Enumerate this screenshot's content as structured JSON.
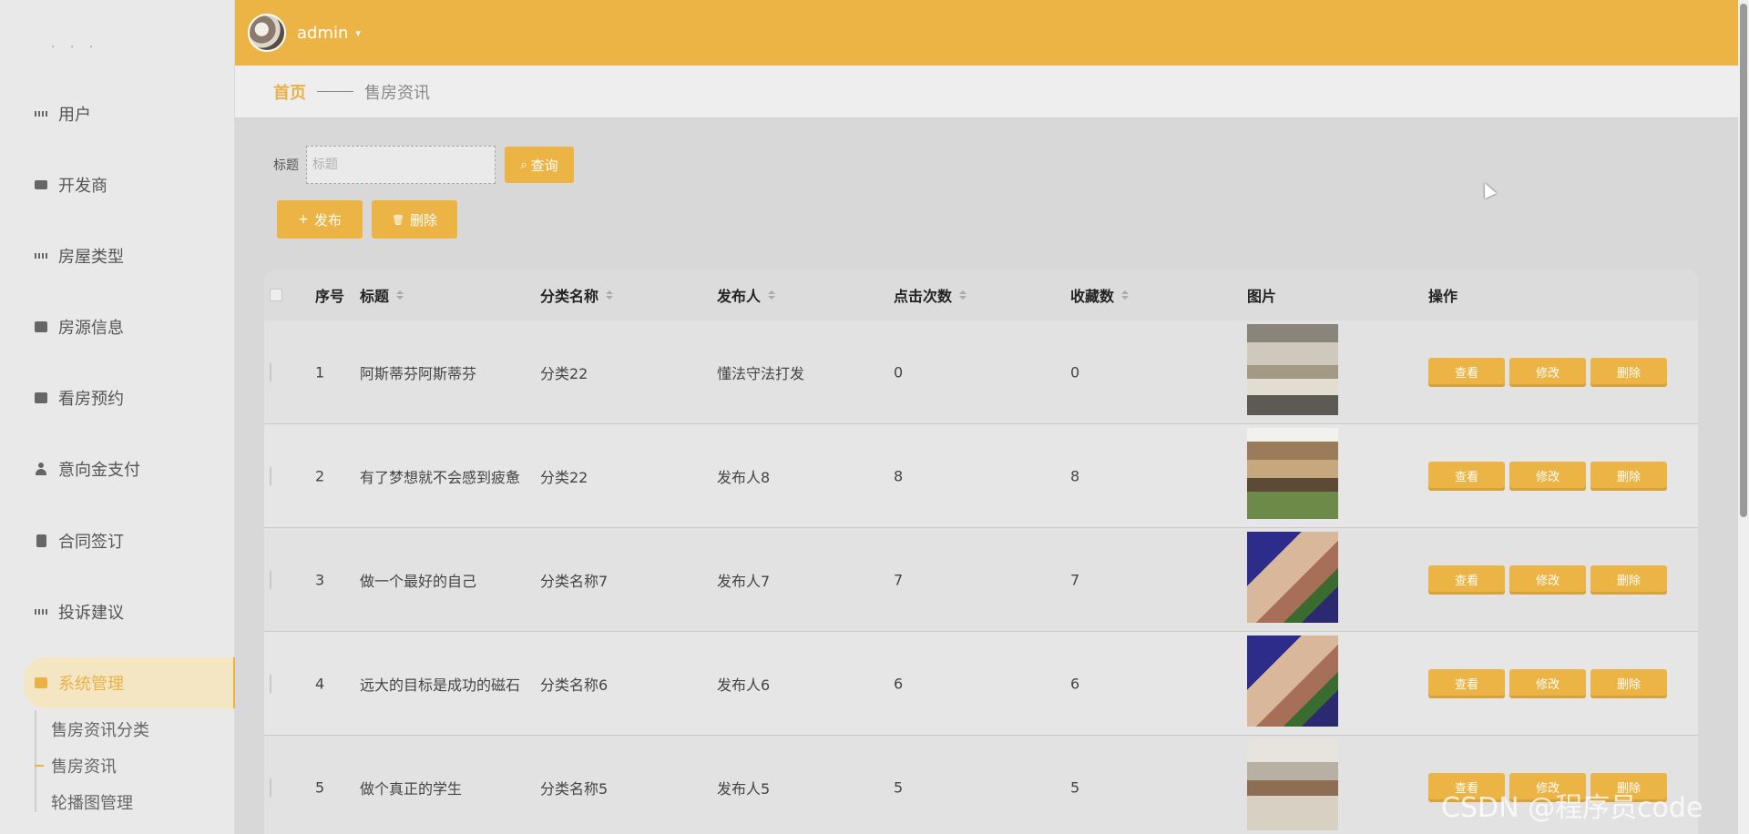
{
  "sidebar": {
    "dots": "· · ·",
    "items": [
      {
        "label": "用户",
        "icon": "grid-icon"
      },
      {
        "label": "开发商",
        "icon": "wallet-icon"
      },
      {
        "label": "房屋类型",
        "icon": "grid-icon"
      },
      {
        "label": "房源信息",
        "icon": "briefcase-icon"
      },
      {
        "label": "看房预约",
        "icon": "chart-icon"
      },
      {
        "label": "意向金支付",
        "icon": "user-icon"
      },
      {
        "label": "合同签订",
        "icon": "clipboard-icon"
      },
      {
        "label": "投诉建议",
        "icon": "grid-icon"
      },
      {
        "label": "系统管理",
        "icon": "monitor-icon",
        "active": true
      }
    ],
    "sub_items": [
      {
        "label": "售房资讯分类"
      },
      {
        "label": "售房资讯",
        "active": true
      },
      {
        "label": "轮播图管理"
      }
    ],
    "accent_color": "#e9b148"
  },
  "header": {
    "username": "admin",
    "caret": "▾",
    "bg_color": "#ebb445"
  },
  "breadcrumb": {
    "home": "首页",
    "current": "售房资讯"
  },
  "search": {
    "label": "标题",
    "placeholder": "标题",
    "value": "",
    "button_label": "查询",
    "button_icon": "⌕"
  },
  "actions": {
    "add_label": "发布",
    "add_icon": "+",
    "delete_label": "删除",
    "delete_icon": "🗑"
  },
  "table": {
    "columns": [
      "序号",
      "标题",
      "分类名称",
      "发布人",
      "点击次数",
      "收藏数",
      "图片",
      "操作"
    ],
    "rows": [
      {
        "index": "1",
        "title": "阿斯蒂芬阿斯蒂芬",
        "category": "分类22",
        "publisher": "懂法守法打发",
        "clicks": "0",
        "favorites": "0"
      },
      {
        "index": "2",
        "title": "有了梦想就不会感到疲惫",
        "category": "分类22",
        "publisher": "发布人8",
        "clicks": "8",
        "favorites": "8"
      },
      {
        "index": "3",
        "title": "做一个最好的自己",
        "category": "分类名称7",
        "publisher": "发布人7",
        "clicks": "7",
        "favorites": "7"
      },
      {
        "index": "4",
        "title": "远大的目标是成功的磁石",
        "category": "分类名称6",
        "publisher": "发布人6",
        "clicks": "6",
        "favorites": "6"
      },
      {
        "index": "5",
        "title": "做个真正的学生",
        "category": "分类名称5",
        "publisher": "发布人5",
        "clicks": "5",
        "favorites": "5"
      }
    ],
    "op_labels": {
      "view": "查看",
      "edit": "修改",
      "delete": "删除"
    }
  },
  "watermark": "CSDN @程序员code"
}
